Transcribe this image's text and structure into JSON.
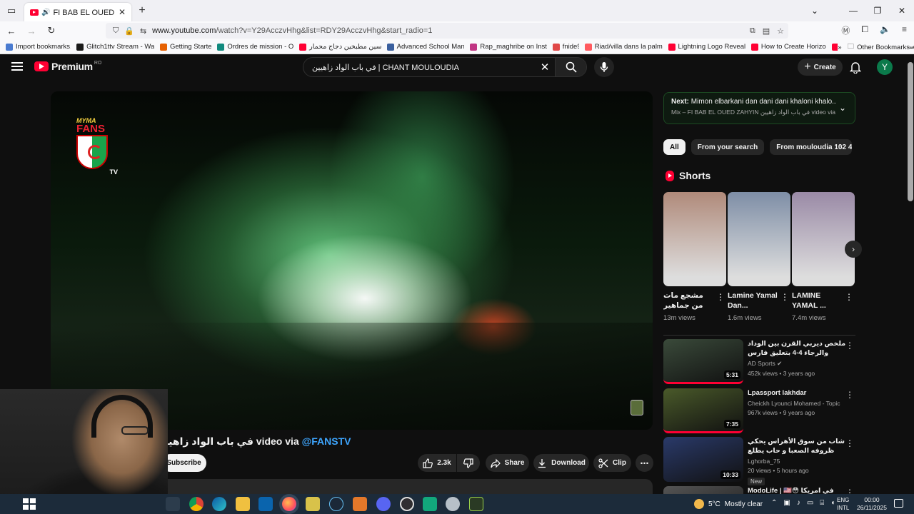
{
  "browser": {
    "tab_title": "FI BAB EL OUED ZAHYIN في",
    "url_host": "www.youtube.com",
    "url_path": "/watch?v=Y29AcczvHhg&list=RDY29AcczvHhg&start_radio=1",
    "bookmarks": [
      {
        "label": "Import bookmarks...",
        "color": "#4a7bd0"
      },
      {
        "label": "Glitch1ttv Stream - Wa...",
        "color": "#1a1a1a"
      },
      {
        "label": "Getting Started",
        "color": "#e66000"
      },
      {
        "label": "Ordres de mission - O...",
        "color": "#118a7e"
      },
      {
        "label": "سين مطبخين دجاج محمار...",
        "color": "#ff0033"
      },
      {
        "label": "Advanced School Man...",
        "color": "#3a5f9e"
      },
      {
        "label": "Rap_maghribe on Inst...",
        "color": "#c13584"
      },
      {
        "label": "fnide9",
        "color": "#e04848"
      },
      {
        "label": "Riad/villa dans la palm...",
        "color": "#ff5a5f"
      },
      {
        "label": "Lightning Logo Reveal...",
        "color": "#ff0033"
      },
      {
        "label": "How to Create Horizo...",
        "color": "#ff0033"
      },
      {
        "label": "سون حليب مقرمش وربط...",
        "color": "#ff0033"
      }
    ],
    "other_bookmarks": "Other Bookmarks"
  },
  "masthead": {
    "logo_text": "Premium",
    "country": "RO",
    "search_query": "في باب الواد زاهيين | CHANT MOULOUDIA",
    "create_label": "Create",
    "avatar_letter": "Y"
  },
  "video": {
    "title_main": "IN في باب الواد زاهيين video via ",
    "title_channel": "@FANSTV",
    "logo_top": "MYMA",
    "logo_fans": "FANS",
    "logo_tv": "TV",
    "subscribe_label": "Subscribe",
    "like_count": "2.3k",
    "share_label": "Share",
    "download_label": "Download",
    "clip_label": "Clip"
  },
  "upnext": {
    "prefix": "Next:",
    "title": "Mimon elbarkani dan dani dani khaloni khalo...",
    "subtitle": "Mix – FI BAB EL OUED ZAHYIN في باب الواد زاهيين video via @FA..."
  },
  "chips": [
    "All",
    "From your search",
    "From mouloudia 102 4..."
  ],
  "shorts": {
    "heading": "Shorts",
    "items": [
      {
        "title": "مشجع مات من جماهير الوداد ❤️",
        "views": "13m views",
        "thumb": "#b08a7a"
      },
      {
        "title": "Lamine Yamal Dan...",
        "views": "1.6m views",
        "thumb": "#7e8ea6"
      },
      {
        "title": "LAMINE YAMAL ...",
        "views": "7.4m views",
        "thumb": "#9a8aa6"
      }
    ]
  },
  "related": [
    {
      "title": "ملخص ديربي القرن بين الوداد والرجاء 4-4 بتعليق فارس عوض",
      "channel": "AD Sports ✔",
      "meta": "452k views • 3 years ago",
      "duration": "5:31",
      "thumb": "#3a4a3a",
      "new": ""
    },
    {
      "title": "Lpassport lakhdar",
      "channel": "Cheickh Lyounci Mohamed - Topic",
      "meta": "967k views • 9 years ago",
      "duration": "7:35",
      "thumb": "#4a5a2a",
      "new": ""
    },
    {
      "title": "شاب من سوق الأهراس يحكي ظروفه الصعبا و حاب يطلع لأوروبا ولا خدمة",
      "channel": "Lghorba_75",
      "meta": "20 views • 5 hours ago",
      "duration": "10:33",
      "thumb": "#2a3a6a",
      "new": "New"
    },
    {
      "title": "ModoLife | 🇺🇸😳 في امريكا",
      "channel": "",
      "meta": "",
      "duration": "",
      "thumb": "#555555",
      "new": ""
    }
  ],
  "taskbar": {
    "weather_temp": "5°C",
    "weather_text": "Mostly clear",
    "lang_top": "ENG",
    "lang_bottom": "INTL",
    "time": "00:00",
    "date": "26/11/2025"
  }
}
